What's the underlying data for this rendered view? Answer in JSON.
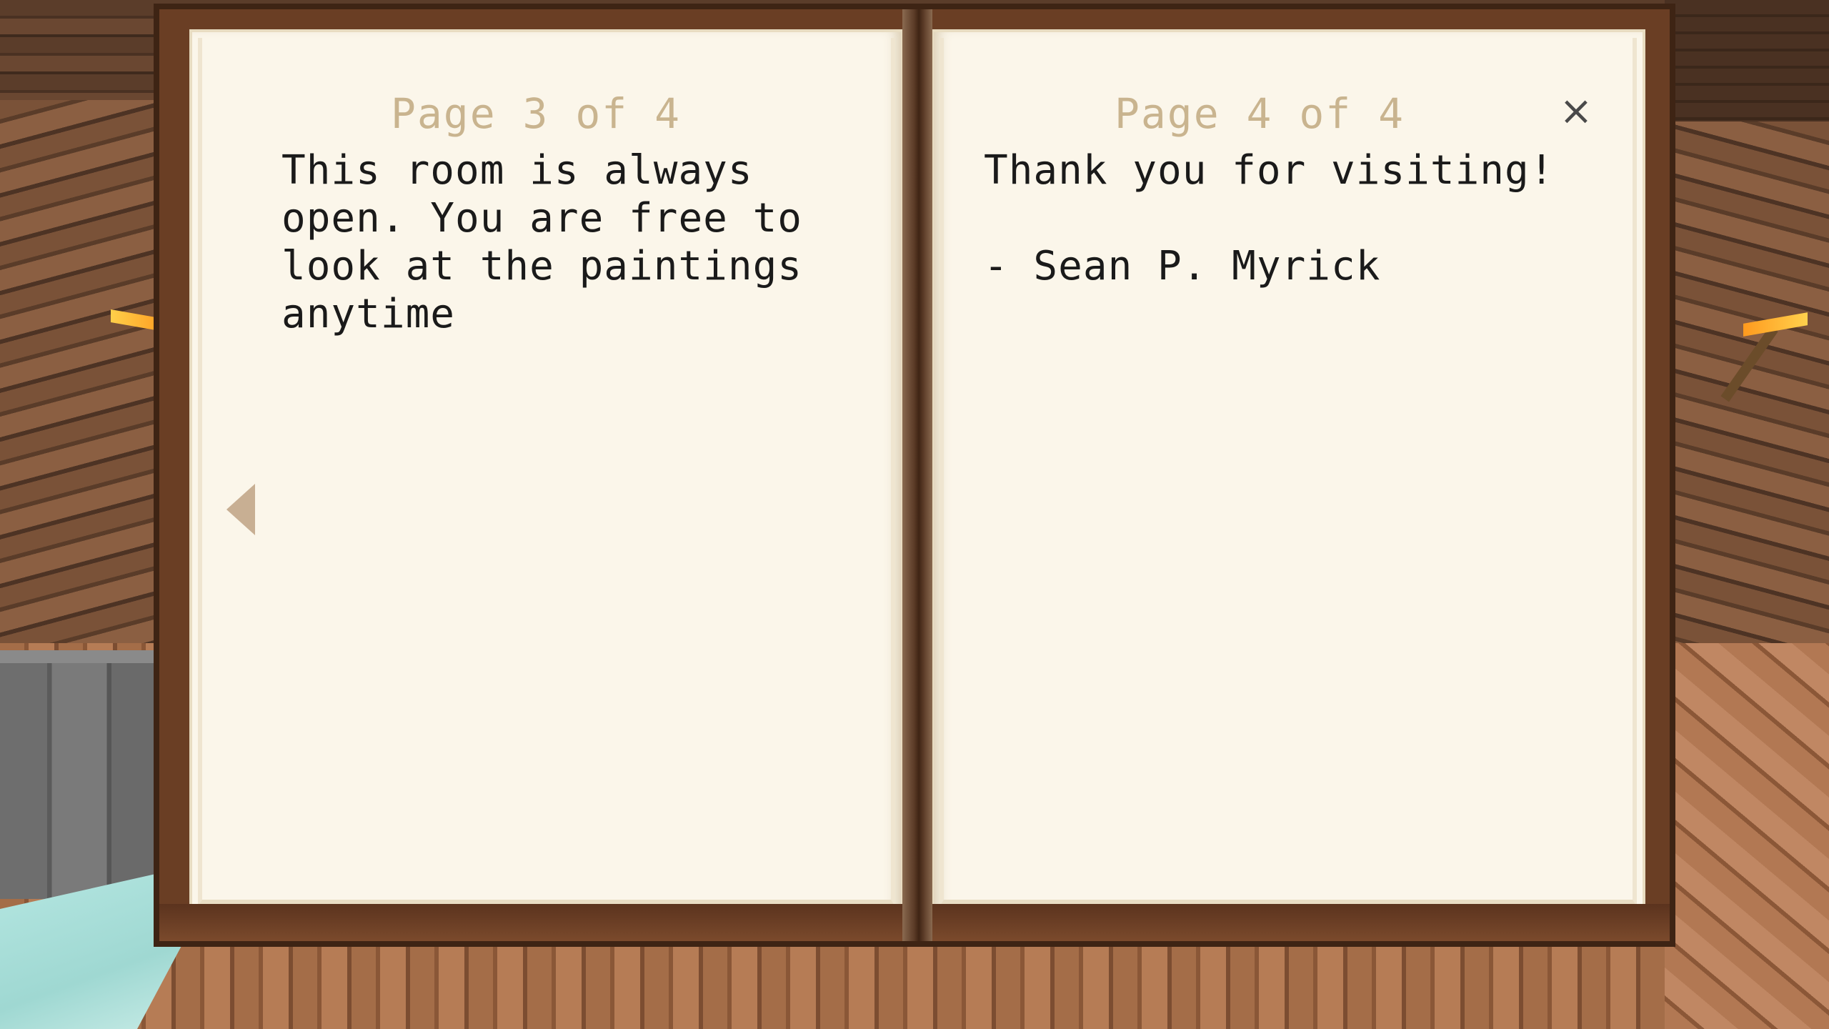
{
  "book": {
    "left_page": {
      "page_label": "Page 3 of 4",
      "text": "This room is always\nopen. You are free to\nlook at the paintings\nanytime"
    },
    "right_page": {
      "page_label": "Page 4 of 4",
      "text": "Thank you for visiting!\n\n- Sean P. Myrick"
    },
    "close_label": "×"
  },
  "icons": {
    "prev_page": "chevron-left-icon",
    "close": "close-icon"
  },
  "colors": {
    "page": "#fbf6ea",
    "page_number": "#c9b48f",
    "text": "#1a1a1a",
    "cover": "#6a3e24"
  }
}
